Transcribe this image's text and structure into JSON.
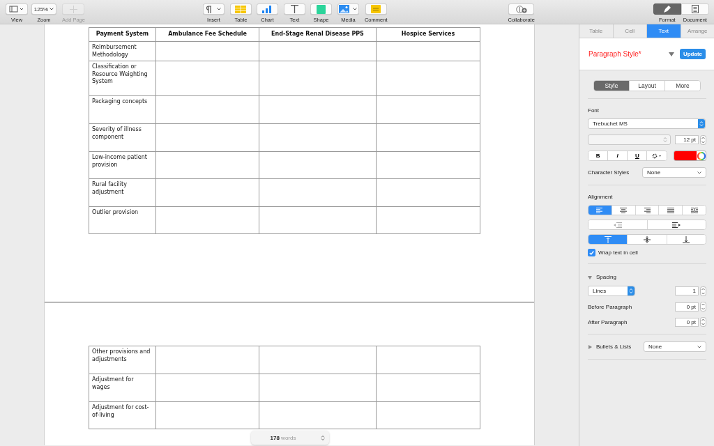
{
  "toolbar": {
    "left": [
      {
        "kind": "view",
        "label": "View",
        "disabled": false
      },
      {
        "kind": "zoom",
        "value": "125%",
        "label": "Zoom",
        "disabled": false
      },
      {
        "kind": "add-page",
        "label": "Add Page",
        "disabled": true
      }
    ],
    "tools": [
      {
        "kind": "insert",
        "label": "Insert"
      },
      {
        "kind": "table",
        "label": "Table"
      },
      {
        "kind": "chart",
        "label": "Chart"
      },
      {
        "kind": "text",
        "label": "Text"
      },
      {
        "kind": "shape",
        "label": "Shape"
      },
      {
        "kind": "media",
        "label": "Media"
      },
      {
        "kind": "comment",
        "label": "Comment"
      }
    ],
    "collaborate": {
      "label": "Collaborate"
    },
    "panels": [
      {
        "kind": "format",
        "label": "Format",
        "selected": true
      },
      {
        "kind": "document",
        "label": "Document",
        "selected": false
      }
    ]
  },
  "document": {
    "pages": [
      {
        "header": [
          "Payment System",
          "Ambulance Fee Schedule",
          "End-Stage Renal Disease PPS",
          "Hospice Services"
        ],
        "rows": [
          [
            "Reimbursement Methodology",
            "",
            "",
            ""
          ],
          [
            "Classification or Resource Weighting System",
            "",
            "",
            ""
          ],
          [
            "Packaging concepts",
            "",
            "",
            ""
          ],
          [
            "Severity of illness component",
            "",
            "",
            ""
          ],
          [
            "Low-income patient provision",
            "",
            "",
            ""
          ],
          [
            "Rural facility adjustment",
            "",
            "",
            ""
          ],
          [
            "Outlier provision",
            "",
            "",
            ""
          ]
        ]
      },
      {
        "rows": [
          [
            "Other provisions and adjustments",
            "",
            "",
            ""
          ],
          [
            "Adjustment for wages",
            "",
            "",
            ""
          ],
          [
            "Adjustment for cost-of-living",
            "",
            "",
            ""
          ]
        ]
      }
    ],
    "word_count": "**178** words"
  },
  "inspector": {
    "tabs": [
      {
        "label": "Table",
        "selected": false
      },
      {
        "label": "Cell",
        "selected": false
      },
      {
        "label": "Text",
        "selected": true
      },
      {
        "label": "Arrange",
        "selected": false
      }
    ],
    "paragraph_style": {
      "name": "Paragraph Style*",
      "button": "Update"
    },
    "subtabs": [
      {
        "label": "Style",
        "selected": true
      },
      {
        "label": "Layout",
        "selected": false
      },
      {
        "label": "More",
        "selected": false
      }
    ],
    "font": {
      "label": "Font",
      "family": "Trebuchet MS",
      "size": "12 pt",
      "color": "#ff0000",
      "styles": [
        {
          "kind": "bold",
          "label": "B"
        },
        {
          "kind": "italic",
          "label": "I"
        },
        {
          "kind": "underline",
          "label": "U"
        }
      ]
    },
    "character_styles": {
      "label": "Character Styles",
      "value": "None"
    },
    "alignment": {
      "label": "Alignment",
      "horizontal": [
        {
          "kind": "left",
          "selected": true
        },
        {
          "kind": "center",
          "selected": false
        },
        {
          "kind": "right",
          "selected": false
        },
        {
          "kind": "justify",
          "selected": false
        },
        {
          "kind": "natural",
          "selected": false
        }
      ],
      "indent": [
        {
          "kind": "decrease"
        },
        {
          "kind": "increase"
        }
      ],
      "vertical": [
        {
          "kind": "top",
          "selected": true
        },
        {
          "kind": "middle",
          "selected": false
        },
        {
          "kind": "bottom",
          "selected": false
        }
      ],
      "wrap": {
        "label": "Wrap text in cell",
        "checked": true
      }
    },
    "spacing": {
      "label": "Spacing",
      "expanded": true,
      "mode": "Lines",
      "lines": "1",
      "fields": [
        {
          "label": "Before Paragraph",
          "value": "0 pt"
        },
        {
          "label": "After Paragraph",
          "value": "0 pt"
        }
      ]
    },
    "bullets": {
      "label": "Bullets & Lists",
      "expanded": false,
      "value": "None"
    }
  }
}
